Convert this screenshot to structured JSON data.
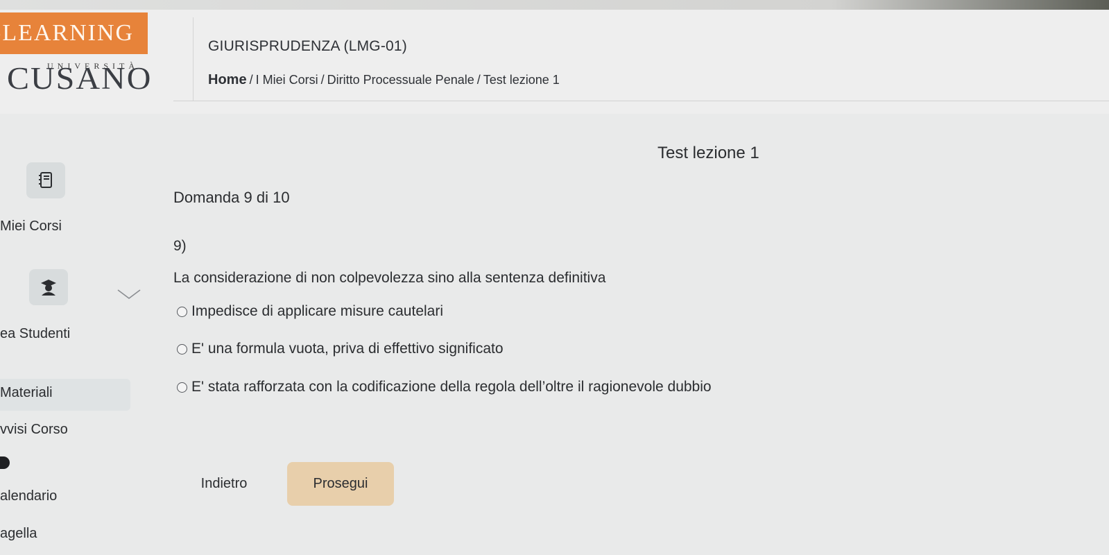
{
  "header": {
    "brand": "-LEARNING",
    "university_small": "UNIVERSITÀ",
    "university_name": "CUSANO",
    "course_title": "GIURISPRUDENZA (LMG-01)",
    "breadcrumb": [
      "Home",
      "I Miei Corsi",
      "Diritto Processuale Penale",
      "Test lezione 1"
    ],
    "breadcrumb_separator": "/"
  },
  "sidebar": {
    "items": [
      {
        "label": "Miei Corsi",
        "icon": "notebook-icon"
      },
      {
        "label": "ea Studenti",
        "icon": "student-icon"
      },
      {
        "label": "Materiali"
      },
      {
        "label": "vvisi Corso"
      },
      {
        "label": "alendario"
      },
      {
        "label": "agella"
      }
    ]
  },
  "main": {
    "test_title": "Test lezione 1",
    "question_count": "Domanda 9 di 10",
    "question_number": "9)",
    "question_text": "La considerazione di non colpevolezza sino alla sentenza definitiva",
    "options": [
      "Impedisce di applicare misure cautelari",
      "E' una formula vuota, priva di effettivo significato",
      "E' stata rafforzata con la codificazione della regola dell’oltre il ragionevole dubbio"
    ],
    "back_label": "Indietro",
    "next_label": "Prosegui"
  },
  "colors": {
    "brand_orange": "#e7833a",
    "next_button": "#e8cfab",
    "background": "#e9eaea"
  }
}
